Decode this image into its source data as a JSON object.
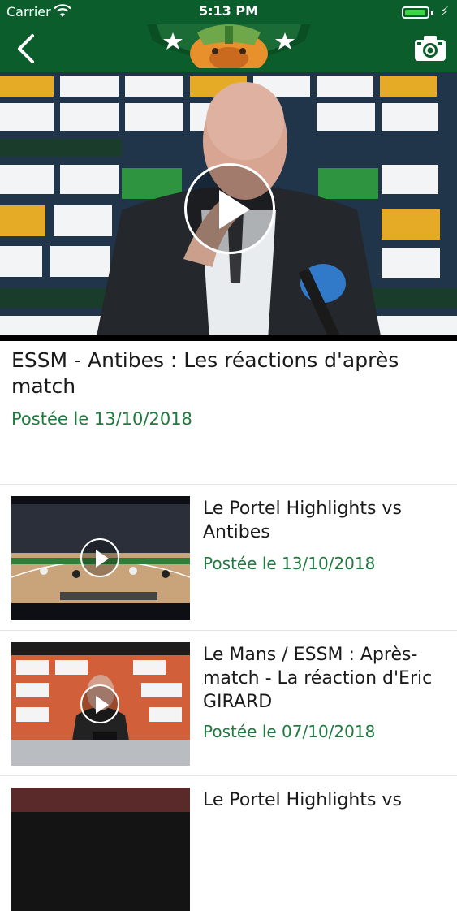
{
  "status_bar": {
    "carrier": "Carrier",
    "time": "5:13 PM",
    "battery_level": 0.95
  },
  "header": {
    "background_color": "#0b5e2c",
    "back_icon": "chevron-left-icon",
    "camera_icon": "camera-icon"
  },
  "featured": {
    "title": "ESSM - Antibes : Les réactions d'après match",
    "date": "Postée le 13/10/2018"
  },
  "videos": [
    {
      "title": "Le Portel Highlights vs Antibes",
      "date": "Postée le 13/10/2018"
    },
    {
      "title": "Le Mans / ESSM : Après-match - La réaction d'Eric GIRARD",
      "date": "Postée le 07/10/2018"
    },
    {
      "title": "Le Portel Highlights vs",
      "date": ""
    }
  ],
  "colors": {
    "accent": "#1e7a3e",
    "header": "#0b5e2c"
  }
}
